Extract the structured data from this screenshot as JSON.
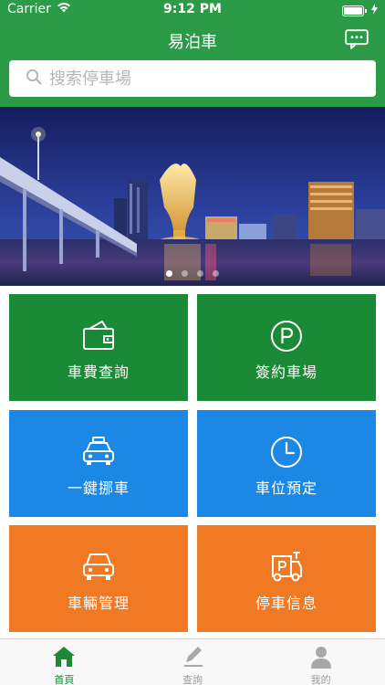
{
  "status_bar": {
    "carrier": "Carrier",
    "time": "9:12 PM"
  },
  "header": {
    "title": "易泊車",
    "chat_icon": "chat-bubble-icon"
  },
  "search": {
    "placeholder": "搜索停車場",
    "value": ""
  },
  "banner": {
    "slides": 4,
    "active_slide": 1
  },
  "tiles": [
    {
      "label": "車費查詢",
      "icon": "wallet-icon",
      "color": "#1b8a36"
    },
    {
      "label": "簽約車場",
      "icon": "parking-icon",
      "color": "#1b8a36"
    },
    {
      "label": "一鍵挪車",
      "icon": "taxi-icon",
      "color": "#1b88e6"
    },
    {
      "label": "車位預定",
      "icon": "clock-icon",
      "color": "#1b88e6"
    },
    {
      "label": "車輛管理",
      "icon": "car-icon",
      "color": "#f07a24"
    },
    {
      "label": "停車信息",
      "icon": "parking-info-icon",
      "color": "#f07a24"
    }
  ],
  "tabbar": {
    "items": [
      {
        "label": "首頁",
        "icon": "home-icon",
        "active": true
      },
      {
        "label": "查詢",
        "icon": "pencil-icon",
        "active": false
      },
      {
        "label": "我的",
        "icon": "user-icon",
        "active": false
      }
    ]
  },
  "colors": {
    "brand_green": "#2b9b47",
    "tile_green": "#1b8a36",
    "tile_blue": "#1b88e6",
    "tile_orange": "#f07a24"
  }
}
